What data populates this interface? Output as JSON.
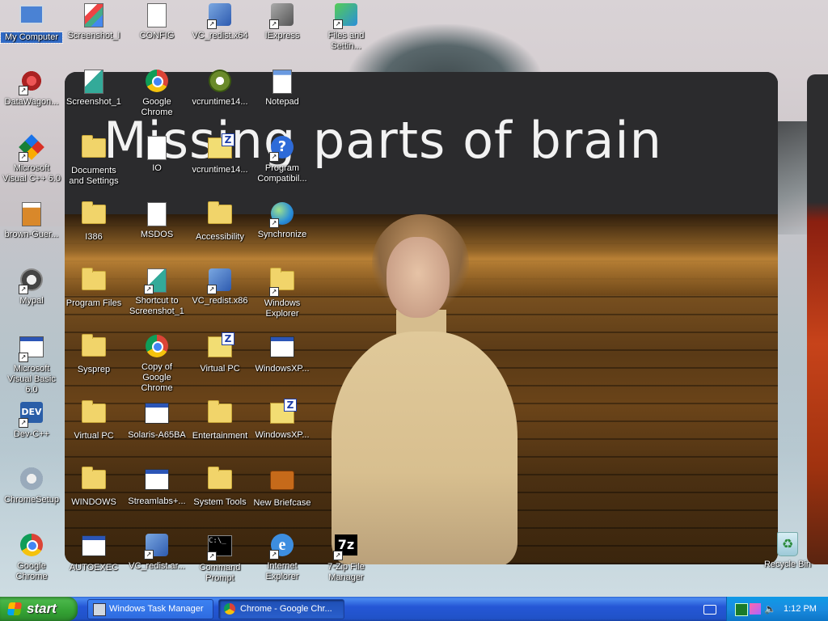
{
  "video": {
    "title": "Missing parts of brain"
  },
  "desktop_icons": [
    {
      "label": "My Computer",
      "icon": "my-computer-icon"
    },
    {
      "label": "Screenshot_I",
      "icon": "image-file-icon"
    },
    {
      "label": "CONFIG",
      "icon": "sys-file-icon"
    },
    {
      "label": "VC_redist.x64",
      "icon": "installer-icon"
    },
    {
      "label": "IExpress",
      "icon": "iexpress-icon"
    },
    {
      "label": "Files and Settin...",
      "icon": "files-transfer-icon"
    },
    {
      "label": "DataWagon...",
      "icon": "datawagon-icon"
    },
    {
      "label": "Screenshot_1",
      "icon": "image-file-icon"
    },
    {
      "label": "Google Chrome",
      "icon": "chrome-icon"
    },
    {
      "label": "vcruntime14...",
      "icon": "gear-icon"
    },
    {
      "label": "Notepad",
      "icon": "notepad-icon"
    },
    {
      "label": "Microsoft Visual C++ 6.0",
      "icon": "visual-cpp-icon"
    },
    {
      "label": "Documents and Settings",
      "icon": "folder-icon"
    },
    {
      "label": "IO",
      "icon": "sys-file-icon"
    },
    {
      "label": "vcruntime14...",
      "icon": "zip-folder-icon"
    },
    {
      "label": "Program Compatibil...",
      "icon": "help-icon"
    },
    {
      "label": "brown-Guer...",
      "icon": "image-file-icon"
    },
    {
      "label": "I386",
      "icon": "folder-icon"
    },
    {
      "label": "MSDOS",
      "icon": "sys-file-icon"
    },
    {
      "label": "Accessibility",
      "icon": "folder-icon"
    },
    {
      "label": "Synchronize",
      "icon": "globe-icon"
    },
    {
      "label": "Mypal",
      "icon": "mypal-icon"
    },
    {
      "label": "Program Files",
      "icon": "folder-icon"
    },
    {
      "label": "Shortcut to Screenshot_1",
      "icon": "image-file-icon"
    },
    {
      "label": "VC_redist.x86",
      "icon": "installer-icon"
    },
    {
      "label": "Windows Explorer",
      "icon": "explorer-icon"
    },
    {
      "label": "Microsoft Visual Basic 6.0",
      "icon": "visual-basic-icon"
    },
    {
      "label": "Sysprep",
      "icon": "folder-icon"
    },
    {
      "label": "Copy of Google Chrome",
      "icon": "chrome-icon"
    },
    {
      "label": "Virtual PC",
      "icon": "zip-folder-icon"
    },
    {
      "label": "WindowsXP...",
      "icon": "window-app-icon"
    },
    {
      "label": "Dev-C++",
      "icon": "dev-cpp-icon"
    },
    {
      "label": "Virtual PC",
      "icon": "folder-icon"
    },
    {
      "label": "Solaris-A65BA",
      "icon": "window-app-icon"
    },
    {
      "label": "Entertainment",
      "icon": "folder-icon"
    },
    {
      "label": "WindowsXP...",
      "icon": "zip-folder-icon"
    },
    {
      "label": "ChromeSetup",
      "icon": "setup-icon"
    },
    {
      "label": "WINDOWS",
      "icon": "folder-icon"
    },
    {
      "label": "Streamlabs+...",
      "icon": "window-app-icon"
    },
    {
      "label": "System Tools",
      "icon": "folder-icon"
    },
    {
      "label": "New Briefcase",
      "icon": "briefcase-icon"
    },
    {
      "label": "Google Chrome",
      "icon": "chrome-icon"
    },
    {
      "label": "AUTOEXEC",
      "icon": "gear-window-icon"
    },
    {
      "label": "VC_redist.ar...",
      "icon": "installer-icon"
    },
    {
      "label": "Command Prompt",
      "icon": "command-prompt-icon"
    },
    {
      "label": "Internet Explorer",
      "icon": "ie-icon"
    },
    {
      "label": "7-Zip File Manager",
      "icon": "7zip-icon"
    },
    {
      "label": "Recycle Bin",
      "icon": "recycle-bin-icon"
    }
  ],
  "taskbar": {
    "start_label": "start",
    "tasks": [
      {
        "label": "Windows Task Manager",
        "icon": "task-manager-icon"
      },
      {
        "label": "Chrome - Google Chr...",
        "icon": "chrome-icon"
      }
    ],
    "clock": "1:12 PM"
  },
  "colors": {
    "taskbar_blue": "#2557d6",
    "start_green": "#34a234",
    "tray_blue": "#1a8ce0",
    "video_bg": "#2b2b2d"
  }
}
